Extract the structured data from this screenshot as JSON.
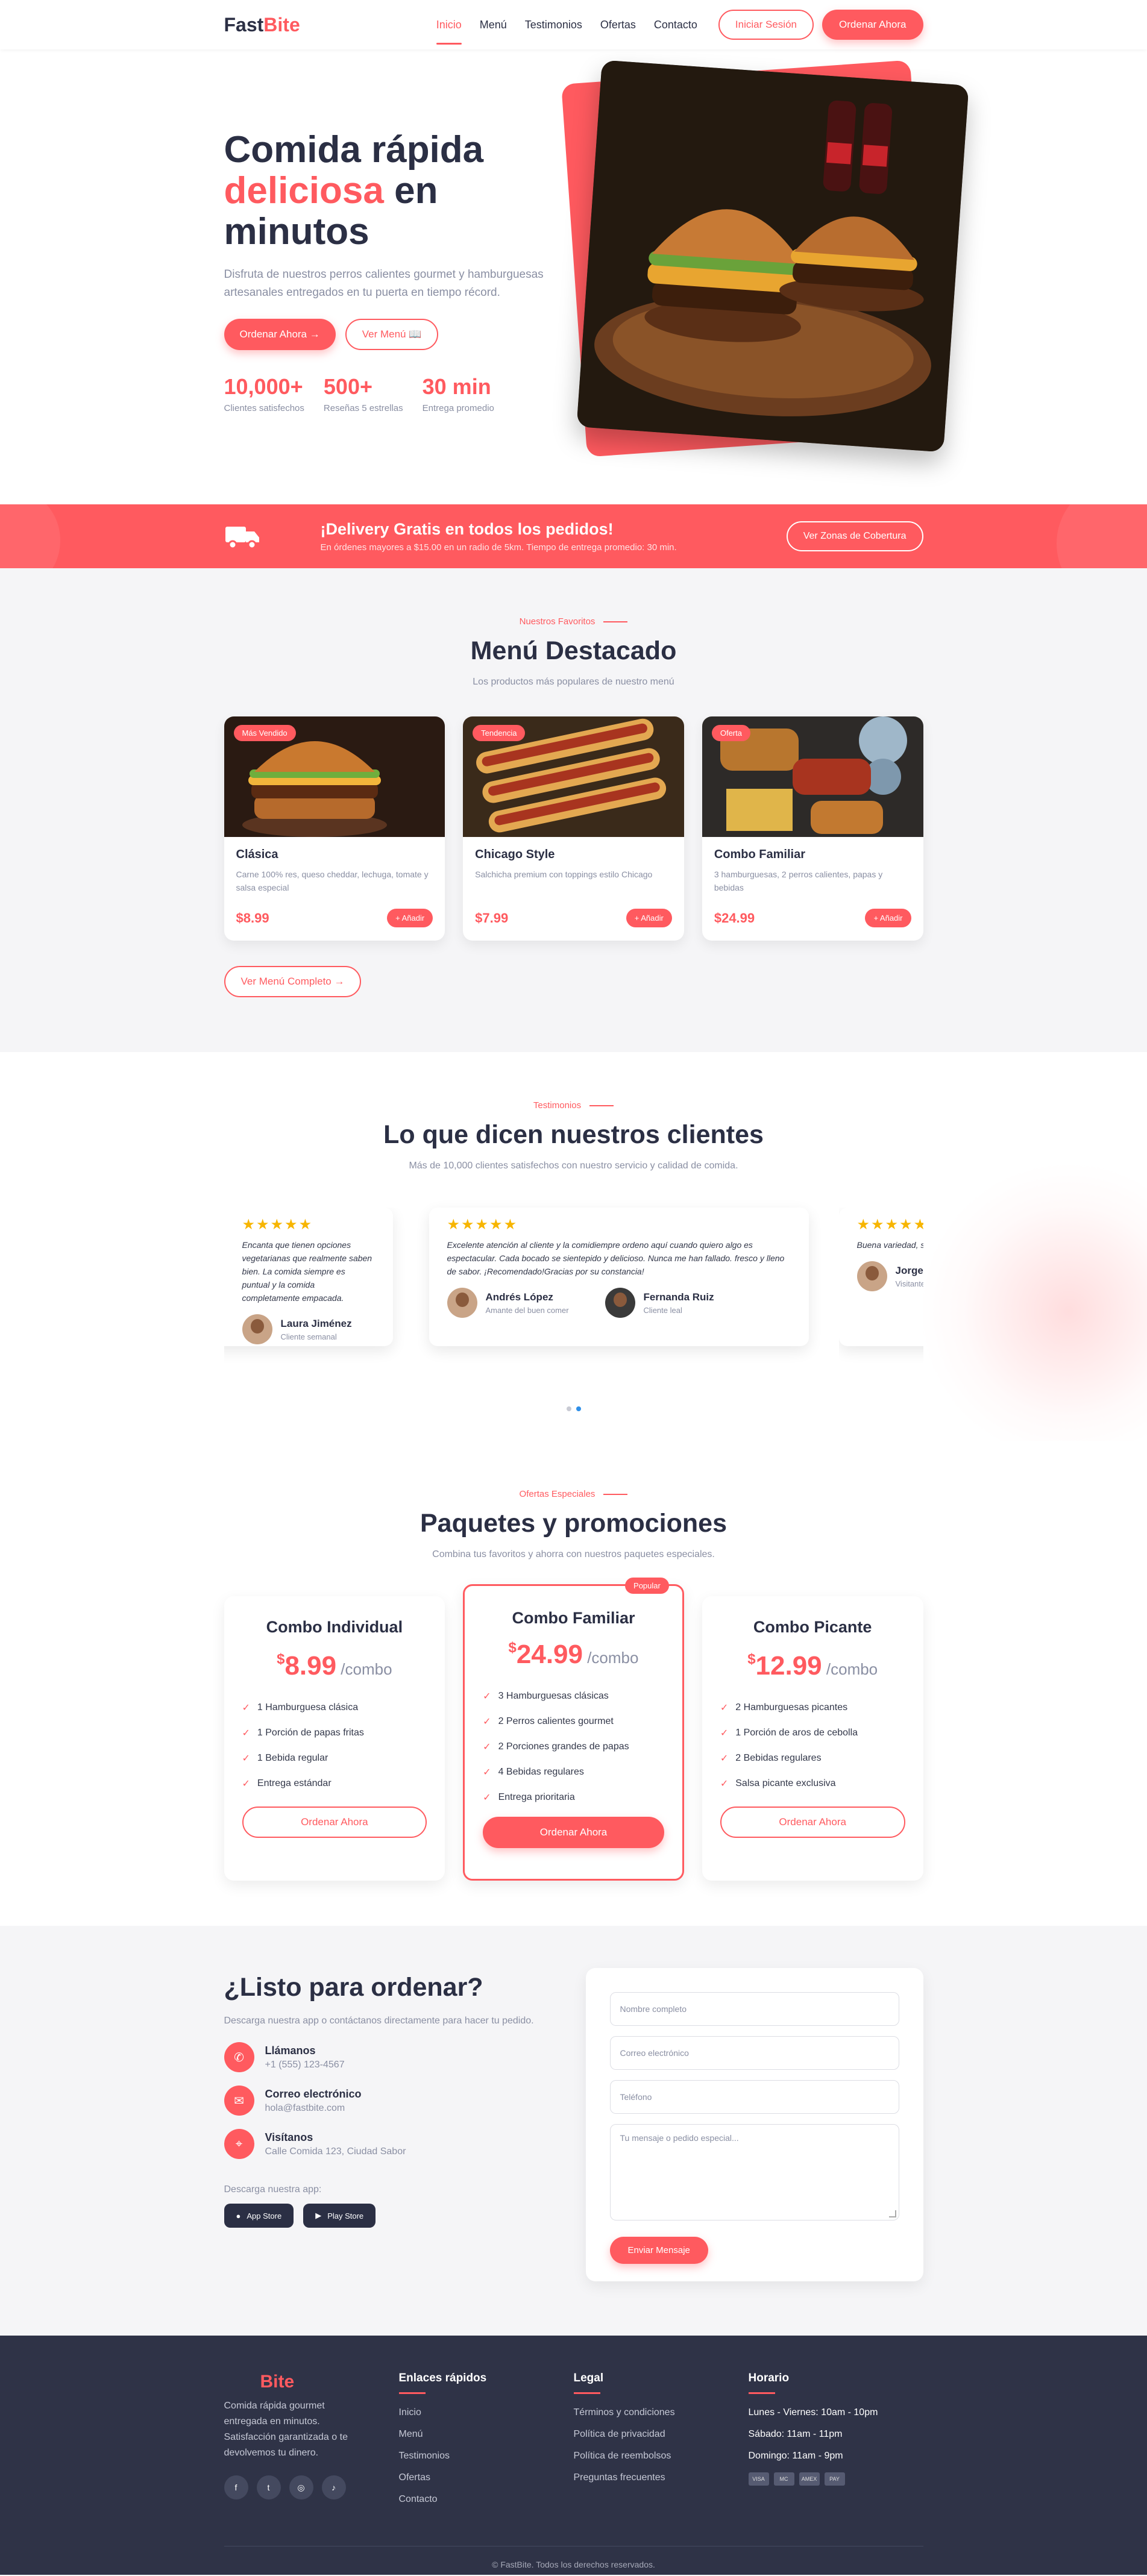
{
  "colors": {
    "accent": "#ff5a5f",
    "dark": "#2b2f44",
    "footer": "#2f3347"
  },
  "nav": {
    "logo_part1": "Fast",
    "logo_part2": "Bite",
    "links": [
      "Inicio",
      "Menú",
      "Testimonios",
      "Ofertas",
      "Contacto"
    ],
    "login": "Iniciar Sesión",
    "order": "Ordenar Ahora"
  },
  "hero": {
    "title_line1": "Comida rápida",
    "title_hl": "deliciosa",
    "title_rest": " en",
    "title_line3": "minutos",
    "desc": "Disfruta de nuestros perros calientes gourmet y hamburguesas artesanales entregados en tu puerta en tiempo récord.",
    "btn_order": "Ordenar Ahora →",
    "btn_menu": "Ver Menú 📖",
    "stats": [
      {
        "num": "10,000+",
        "label": "Clientes satisfechos"
      },
      {
        "num": "500+",
        "label": "Reseñas 5 estrellas"
      },
      {
        "num": "30 min",
        "label": "Entrega promedio"
      }
    ],
    "image_icon": "burger-photo"
  },
  "delivery": {
    "icon": "truck-icon",
    "title": "¡Delivery Gratis en todos los pedidos!",
    "sub": "En órdenes mayores a $15.00 en un radio de 5km. Tiempo de entrega promedio: 30 min.",
    "button": "Ver Zonas de Cobertura"
  },
  "menu": {
    "tag": "Nuestros Favoritos",
    "title": "Menú Destacado",
    "sub": "Los productos más populares de nuestro menú",
    "items": [
      {
        "badge": "Más Vendido",
        "name": "Clásica",
        "desc": "Carne 100% res, queso cheddar, lechuga, tomate y salsa especial",
        "price": "$8.99",
        "add": "+ Añadir"
      },
      {
        "badge": "Tendencia",
        "name": "Chicago Style",
        "desc": "Salchicha premium con toppings estilo Chicago",
        "price": "$7.99",
        "add": "+ Añadir"
      },
      {
        "badge": "Oferta",
        "name": "Combo Familiar",
        "desc": "3 hamburguesas, 2 perros calientes, papas y bebidas",
        "price": "$24.99",
        "add": "+ Añadir"
      }
    ],
    "more": "Ver Menú Completo →"
  },
  "testimonials": {
    "tag": "Testimonios",
    "title": "Lo que dicen nuestros clientes",
    "sub": "Más de 10,000 clientes satisfechos con nuestro servicio y calidad de comida.",
    "stars": "★★★★★",
    "items": [
      {
        "quote": "Encanta que tienen opciones vegetarianas que realmente saben bien. La comida siempre es puntual y la comida completamente empacada.",
        "name": "Laura Jiménez",
        "role": "Cliente semanal"
      },
      {
        "quote": "Excelente atención al cliente y la comidiempre ordeno aquí cuando quiero algo es espectacular. Cada bocado se sientepido y delicioso. Nunca me han fallado. fresco y lleno de sabor. ¡Recomendado!Gracias por su constancia!",
        "name": "Andrés López",
        "role": "Amante del buen comer"
      },
      {
        "quote": "",
        "name": "Fernanda Ruiz",
        "role": "Cliente leal"
      },
      {
        "quote": "Buena variedad, son una delicia, tiempos de entrega",
        "name": "Jorge",
        "role": "Visitante"
      }
    ]
  },
  "packages": {
    "tag": "Ofertas Especiales",
    "title": "Paquetes y promociones",
    "sub": "Combina tus favoritos y ahorra con nuestros paquetes especiales.",
    "items": [
      {
        "name": "Combo Individual",
        "currency": "$",
        "amount": "8.99",
        "per": " /combo",
        "features": [
          "1 Hamburguesa clásica",
          "1 Porción de papas fritas",
          "1 Bebida regular",
          "Entrega estándar"
        ],
        "button": "Ordenar Ahora"
      },
      {
        "name": "Combo Familiar",
        "tag": "Popular",
        "currency": "$",
        "amount": "24.99",
        "per": " /combo",
        "features": [
          "3 Hamburguesas clásicas",
          "2 Perros calientes gourmet",
          "2 Porciones grandes de papas",
          "4 Bebidas regulares",
          "Entrega prioritaria"
        ],
        "button": "Ordenar Ahora"
      },
      {
        "name": "Combo Picante",
        "currency": "$",
        "amount": "12.99",
        "per": " /combo",
        "features": [
          "2 Hamburguesas picantes",
          "1 Porción de aros de cebolla",
          "2 Bebidas regulares",
          "Salsa picante exclusiva"
        ],
        "button": "Ordenar Ahora"
      }
    ]
  },
  "contact": {
    "title": "¿Listo para ordenar?",
    "desc": "Descarga nuestra app o contáctanos directamente para hacer tu pedido.",
    "items": [
      {
        "icon": "phone-icon",
        "title": "Llámanos",
        "value": "+1 (555) 123-4567"
      },
      {
        "icon": "mail-icon",
        "title": "Correo electrónico",
        "value": "hola@fastbite.com"
      },
      {
        "icon": "location-icon",
        "title": "Visítanos",
        "value": "Calle Comida 123, Ciudad Sabor"
      }
    ],
    "download_label": "Descarga nuestra app:",
    "app_store": "App Store",
    "play_store": "Play Store",
    "form": {
      "name": "Nombre completo",
      "email": "Correo electrónico",
      "phone": "Teléfono",
      "message": "Tu mensaje o pedido especial...",
      "submit": "Enviar Mensaje"
    }
  },
  "footer": {
    "logo": "Bite",
    "desc": "Comida rápida gourmet entregada en minutos. Satisfacción garantizada o te devolvemos tu dinero.",
    "socials": [
      "f",
      "t",
      "◎",
      "♪"
    ],
    "quick_title": "Enlaces rápidos",
    "quick_links": [
      "Inicio",
      "Menú",
      "Testimonios",
      "Ofertas",
      "Contacto"
    ],
    "legal_title": "Legal",
    "legal_links": [
      "Términos y condiciones",
      "Política de privacidad",
      "Política de reembolsos",
      "Preguntas frecuentes"
    ],
    "hours_title": "Horario",
    "hours": [
      "Lunes - Viernes: 10am - 10pm",
      "Sábado: 11am - 11pm",
      "Domingo: 11am - 9pm"
    ],
    "payments": [
      "VISA",
      "MC",
      "AMEX",
      "PAY"
    ],
    "copyright": "© FastBite. Todos los derechos reservados."
  }
}
